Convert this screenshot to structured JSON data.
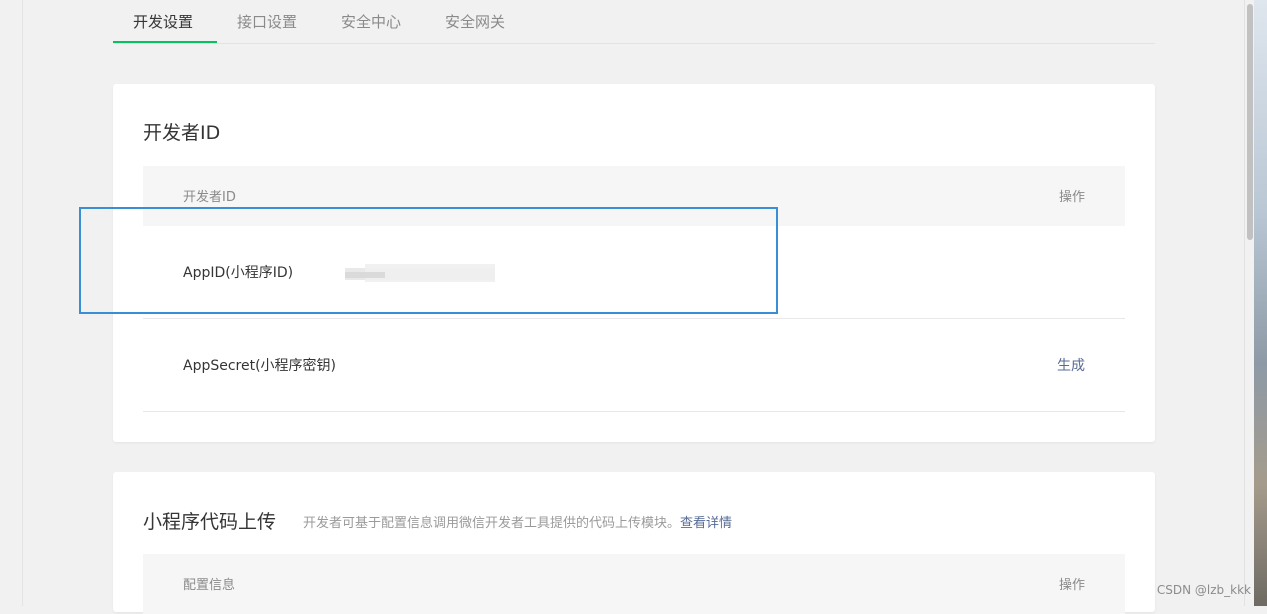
{
  "tabs": [
    {
      "label": "开发设置",
      "active": true
    },
    {
      "label": "接口设置",
      "active": false
    },
    {
      "label": "安全中心",
      "active": false
    },
    {
      "label": "安全网关",
      "active": false
    }
  ],
  "colors": {
    "accent": "#07c160",
    "link": "#576b95",
    "highlight_box": "#3a8ed6"
  },
  "developer_card": {
    "title": "开发者ID",
    "table_header": {
      "name_col": "开发者ID",
      "action_col": "操作"
    },
    "rows": [
      {
        "label": "AppID(小程序ID)",
        "action": ""
      },
      {
        "label": "AppSecret(小程序密钥)",
        "action": "生成"
      }
    ]
  },
  "upload_card": {
    "title": "小程序代码上传",
    "description": "开发者可基于配置信息调用微信开发者工具提供的代码上传模块。",
    "details_link": "查看详情",
    "table_header": {
      "name_col": "配置信息",
      "action_col": "操作"
    }
  },
  "watermark": "CSDN @lzb_kkk"
}
